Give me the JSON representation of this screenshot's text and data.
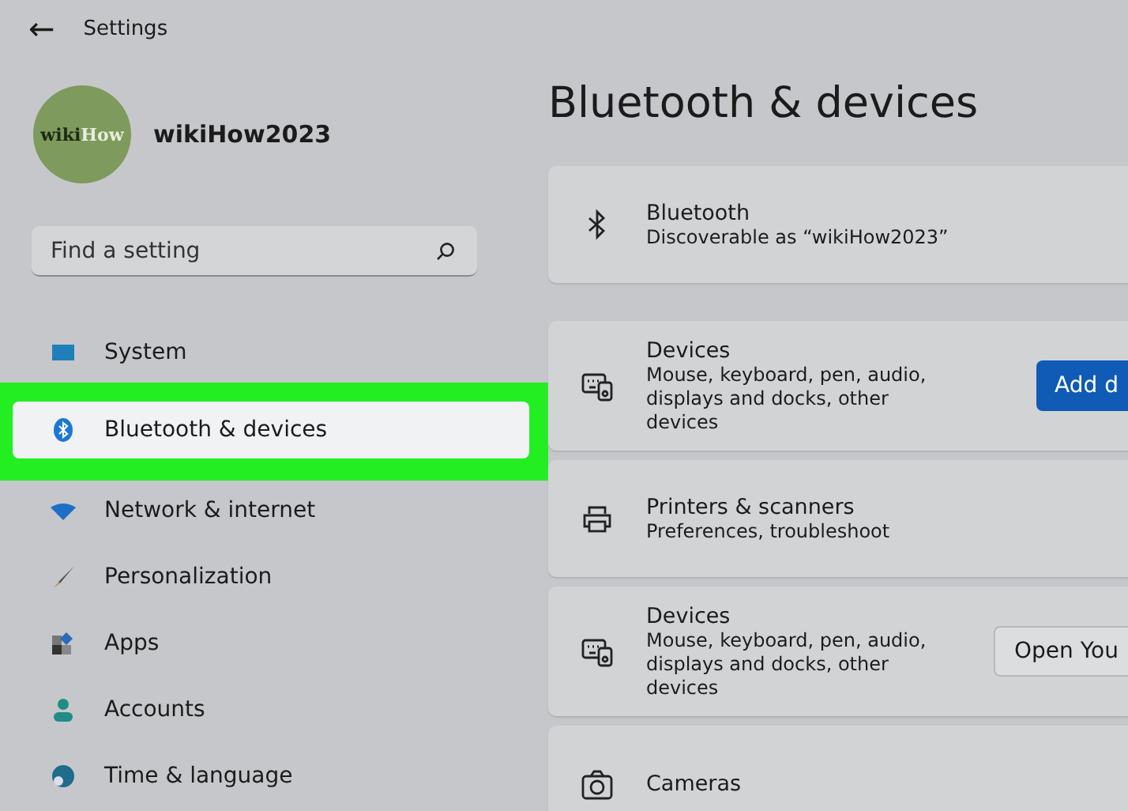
{
  "header": {
    "back": "←",
    "title": "Settings"
  },
  "profile": {
    "avatar_left": "wiki",
    "avatar_right": "How",
    "name": "wikiHow2023"
  },
  "search": {
    "placeholder": "Find a setting"
  },
  "nav": [
    {
      "label": "System",
      "kind": "system",
      "selected": false,
      "highlight": false
    },
    {
      "label": "Bluetooth & devices",
      "kind": "bluetooth",
      "selected": true,
      "highlight": true
    },
    {
      "label": "Network & internet",
      "kind": "wifi",
      "selected": false,
      "highlight": false
    },
    {
      "label": "Personalization",
      "kind": "brush",
      "selected": false,
      "highlight": false
    },
    {
      "label": "Apps",
      "kind": "apps",
      "selected": false,
      "highlight": false
    },
    {
      "label": "Accounts",
      "kind": "person",
      "selected": false,
      "highlight": false
    },
    {
      "label": "Time & language",
      "kind": "globe",
      "selected": false,
      "highlight": false
    }
  ],
  "page_title": "Bluetooth & devices",
  "cards": [
    {
      "kind": "bluetooth",
      "title": "Bluetooth",
      "subtitle": "Discoverable as “wikiHow2023”"
    },
    {
      "kind": "devices",
      "title": "Devices",
      "subtitle": "Mouse, keyboard, pen, audio, displays and docks, other devices",
      "button": {
        "label": "Add d",
        "kind": "primary"
      }
    },
    {
      "kind": "printer",
      "title": "Printers & scanners",
      "subtitle": "Preferences, troubleshoot"
    },
    {
      "kind": "devices",
      "title": "Devices",
      "subtitle": "Mouse, keyboard, pen, audio, displays and docks, other devices",
      "button": {
        "label": "Open You",
        "kind": "secondary"
      }
    },
    {
      "kind": "camera",
      "title": "Cameras"
    }
  ]
}
